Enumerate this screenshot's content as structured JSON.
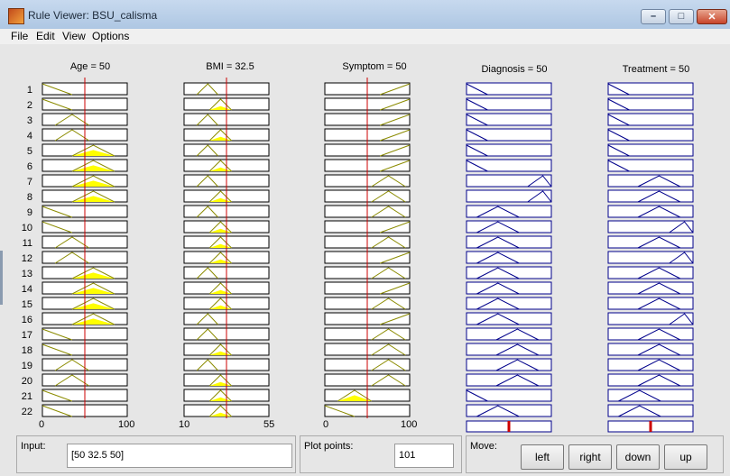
{
  "window": {
    "title": "Rule Viewer: BSU_calisma"
  },
  "menu": [
    "File",
    "Edit",
    "View",
    "Options"
  ],
  "inputs": [
    {
      "title": "Age = 50",
      "value": 50,
      "range": [
        0,
        100
      ],
      "ticks": [
        "0",
        "100"
      ]
    },
    {
      "title": "BMI = 32.5",
      "value": 32.5,
      "range": [
        10,
        55
      ],
      "ticks": [
        "10",
        "55"
      ]
    },
    {
      "title": "Symptom = 50",
      "value": 50,
      "range": [
        0,
        100
      ],
      "ticks": [
        "0",
        "100"
      ]
    }
  ],
  "outputs": [
    {
      "title": "Diagnosis = 50",
      "value": 50,
      "range": [
        0,
        100
      ]
    },
    {
      "title": "Treatment = 50",
      "value": 50,
      "range": [
        0,
        100
      ]
    }
  ],
  "rules": [
    {
      "n": "1",
      "age": [
        "L",
        0
      ],
      "bmi": [
        "L",
        0
      ],
      "sym": [
        "H",
        0
      ],
      "diag": [
        "L",
        0.05
      ],
      "treat": [
        "L",
        0.05
      ]
    },
    {
      "n": "2",
      "age": [
        "L",
        0
      ],
      "bmi": [
        "M",
        0.35
      ],
      "sym": [
        "H",
        0
      ],
      "diag": [
        "L",
        0.05
      ],
      "treat": [
        "L",
        0.05
      ]
    },
    {
      "n": "3",
      "age": [
        "LM",
        0
      ],
      "bmi": [
        "L",
        0
      ],
      "sym": [
        "H",
        0
      ],
      "diag": [
        "L",
        0.05
      ],
      "treat": [
        "L",
        0.05
      ]
    },
    {
      "n": "4",
      "age": [
        "LM",
        0
      ],
      "bmi": [
        "M",
        0.35
      ],
      "sym": [
        "H",
        0
      ],
      "diag": [
        "L",
        0.05
      ],
      "treat": [
        "L",
        0.05
      ]
    },
    {
      "n": "5",
      "age": [
        "M",
        0.55
      ],
      "bmi": [
        "L",
        0
      ],
      "sym": [
        "H",
        0
      ],
      "diag": [
        "L",
        0.05
      ],
      "treat": [
        "L",
        0.05
      ]
    },
    {
      "n": "6",
      "age": [
        "M",
        0.55
      ],
      "bmi": [
        "M",
        0.35
      ],
      "sym": [
        "H",
        0
      ],
      "diag": [
        "L",
        0.05
      ],
      "treat": [
        "L",
        0.05
      ]
    },
    {
      "n": "7",
      "age": [
        "M",
        0.55
      ],
      "bmi": [
        "L",
        0
      ],
      "sym": [
        "MH",
        0
      ],
      "diag": [
        "H",
        0.05
      ],
      "treat": [
        "M",
        0.05
      ]
    },
    {
      "n": "8",
      "age": [
        "M",
        0.55
      ],
      "bmi": [
        "M",
        0.35
      ],
      "sym": [
        "MH",
        0
      ],
      "diag": [
        "H",
        0.05
      ],
      "treat": [
        "M",
        0.05
      ]
    },
    {
      "n": "9",
      "age": [
        "L",
        0
      ],
      "bmi": [
        "L",
        0
      ],
      "sym": [
        "MH",
        0
      ],
      "diag": [
        "LM",
        0.05
      ],
      "treat": [
        "M",
        0.05
      ]
    },
    {
      "n": "10",
      "age": [
        "L",
        0
      ],
      "bmi": [
        "M",
        0.35
      ],
      "sym": [
        "H",
        0
      ],
      "diag": [
        "LM",
        0.05
      ],
      "treat": [
        "H",
        0.05
      ]
    },
    {
      "n": "11",
      "age": [
        "LM",
        0
      ],
      "bmi": [
        "M",
        0.35
      ],
      "sym": [
        "MH",
        0
      ],
      "diag": [
        "LM",
        0.05
      ],
      "treat": [
        "M",
        0.05
      ]
    },
    {
      "n": "12",
      "age": [
        "LM",
        0
      ],
      "bmi": [
        "M",
        0.35
      ],
      "sym": [
        "H",
        0
      ],
      "diag": [
        "LM",
        0.05
      ],
      "treat": [
        "H",
        0.05
      ]
    },
    {
      "n": "13",
      "age": [
        "M",
        0.55
      ],
      "bmi": [
        "L",
        0
      ],
      "sym": [
        "MH",
        0
      ],
      "diag": [
        "LM",
        0.05
      ],
      "treat": [
        "M",
        0.05
      ]
    },
    {
      "n": "14",
      "age": [
        "M",
        0.55
      ],
      "bmi": [
        "M",
        0.35
      ],
      "sym": [
        "H",
        0
      ],
      "diag": [
        "LM",
        0.05
      ],
      "treat": [
        "M",
        0.05
      ]
    },
    {
      "n": "15",
      "age": [
        "M",
        0.55
      ],
      "bmi": [
        "M",
        0.35
      ],
      "sym": [
        "MH",
        0
      ],
      "diag": [
        "LM",
        0.05
      ],
      "treat": [
        "M",
        0.05
      ]
    },
    {
      "n": "16",
      "age": [
        "M",
        0.55
      ],
      "bmi": [
        "L",
        0
      ],
      "sym": [
        "H",
        0
      ],
      "diag": [
        "LM",
        0.05
      ],
      "treat": [
        "H",
        0.05
      ]
    },
    {
      "n": "17",
      "age": [
        "L",
        0
      ],
      "bmi": [
        "L",
        0
      ],
      "sym": [
        "MH",
        0
      ],
      "diag": [
        "M",
        0.05
      ],
      "treat": [
        "M",
        0.05
      ]
    },
    {
      "n": "18",
      "age": [
        "L",
        0
      ],
      "bmi": [
        "M",
        0.35
      ],
      "sym": [
        "MH",
        0
      ],
      "diag": [
        "M",
        0.05
      ],
      "treat": [
        "M",
        0.05
      ]
    },
    {
      "n": "19",
      "age": [
        "LM",
        0
      ],
      "bmi": [
        "L",
        0
      ],
      "sym": [
        "MH",
        0
      ],
      "diag": [
        "M",
        0.05
      ],
      "treat": [
        "M",
        0.05
      ]
    },
    {
      "n": "20",
      "age": [
        "LM",
        0
      ],
      "bmi": [
        "M",
        0.35
      ],
      "sym": [
        "MH",
        0
      ],
      "diag": [
        "M",
        0.05
      ],
      "treat": [
        "M",
        0.05
      ]
    },
    {
      "n": "21",
      "age": [
        "L",
        0
      ],
      "bmi": [
        "M",
        0.35
      ],
      "sym": [
        "LM",
        0.55
      ],
      "diag": [
        "L",
        0.05
      ],
      "treat": [
        "LM",
        0.05
      ]
    },
    {
      "n": "22",
      "age": [
        "L",
        0
      ],
      "bmi": [
        "M",
        0.35
      ],
      "sym": [
        "L",
        0
      ],
      "diag": [
        "LM",
        0.05
      ],
      "treat": [
        "LM",
        0.05
      ]
    }
  ],
  "colors": {
    "input_line": "#8b8b00",
    "fill": "#ffff00",
    "output_line": "#00008b",
    "cursor": "#cc0000"
  },
  "bottom": {
    "input_label": "Input:",
    "input_value": "[50 32.5 50]",
    "plot_points_label": "Plot points:",
    "plot_points_value": "101",
    "move_label": "Move:",
    "buttons": [
      "left",
      "right",
      "down",
      "up"
    ]
  }
}
